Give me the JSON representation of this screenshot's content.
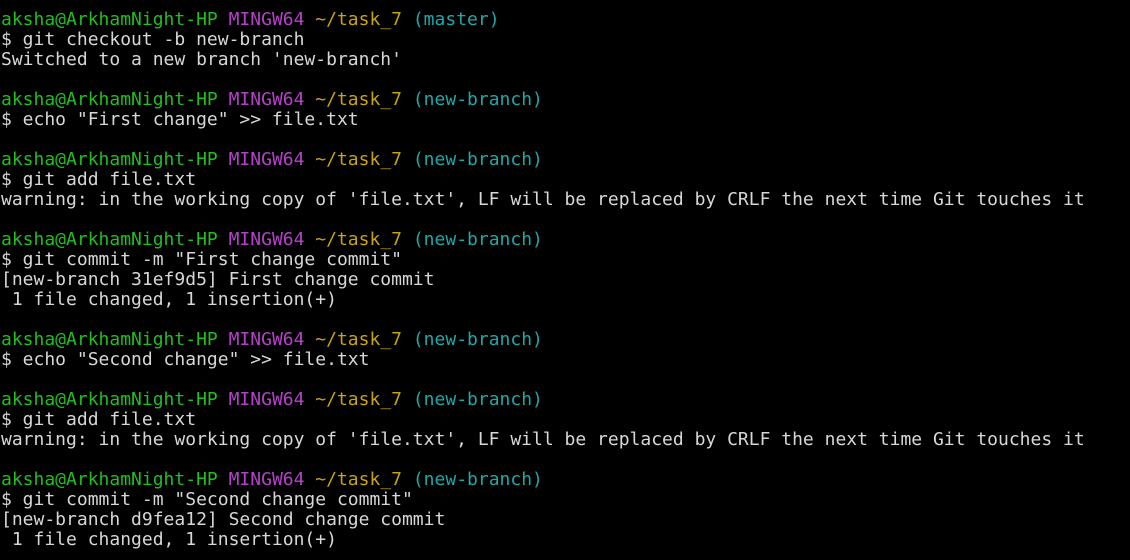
{
  "colors": {
    "background": "#000000",
    "text": "#d7d7d7",
    "user_host": "#1fbf1f",
    "system": "#b541c9",
    "path": "#c8a40c",
    "branch": "#1fa8a8"
  },
  "lines": [
    {
      "kind": "prompt",
      "user_host": "aksha@ArkhamNight-HP",
      "system": "MINGW64",
      "path": "~/task_7",
      "branch": "(master)"
    },
    {
      "kind": "text",
      "text": "$ git checkout -b new-branch"
    },
    {
      "kind": "text",
      "text": "Switched to a new branch 'new-branch'"
    },
    {
      "kind": "text",
      "text": ""
    },
    {
      "kind": "prompt",
      "user_host": "aksha@ArkhamNight-HP",
      "system": "MINGW64",
      "path": "~/task_7",
      "branch": "(new-branch)"
    },
    {
      "kind": "text",
      "text": "$ echo \"First change\" >> file.txt"
    },
    {
      "kind": "text",
      "text": ""
    },
    {
      "kind": "prompt",
      "user_host": "aksha@ArkhamNight-HP",
      "system": "MINGW64",
      "path": "~/task_7",
      "branch": "(new-branch)"
    },
    {
      "kind": "text",
      "text": "$ git add file.txt"
    },
    {
      "kind": "text",
      "text": "warning: in the working copy of 'file.txt', LF will be replaced by CRLF the next time Git touches it"
    },
    {
      "kind": "text",
      "text": ""
    },
    {
      "kind": "prompt",
      "user_host": "aksha@ArkhamNight-HP",
      "system": "MINGW64",
      "path": "~/task_7",
      "branch": "(new-branch)"
    },
    {
      "kind": "text",
      "text": "$ git commit -m \"First change commit\""
    },
    {
      "kind": "text",
      "text": "[new-branch 31ef9d5] First change commit"
    },
    {
      "kind": "text",
      "text": " 1 file changed, 1 insertion(+)"
    },
    {
      "kind": "text",
      "text": ""
    },
    {
      "kind": "prompt",
      "user_host": "aksha@ArkhamNight-HP",
      "system": "MINGW64",
      "path": "~/task_7",
      "branch": "(new-branch)"
    },
    {
      "kind": "text",
      "text": "$ echo \"Second change\" >> file.txt"
    },
    {
      "kind": "text",
      "text": ""
    },
    {
      "kind": "prompt",
      "user_host": "aksha@ArkhamNight-HP",
      "system": "MINGW64",
      "path": "~/task_7",
      "branch": "(new-branch)"
    },
    {
      "kind": "text",
      "text": "$ git add file.txt"
    },
    {
      "kind": "text",
      "text": "warning: in the working copy of 'file.txt', LF will be replaced by CRLF the next time Git touches it"
    },
    {
      "kind": "text",
      "text": ""
    },
    {
      "kind": "prompt",
      "user_host": "aksha@ArkhamNight-HP",
      "system": "MINGW64",
      "path": "~/task_7",
      "branch": "(new-branch)"
    },
    {
      "kind": "text",
      "text": "$ git commit -m \"Second change commit\""
    },
    {
      "kind": "text",
      "text": "[new-branch d9fea12] Second change commit"
    },
    {
      "kind": "text",
      "text": " 1 file changed, 1 insertion(+)"
    }
  ]
}
